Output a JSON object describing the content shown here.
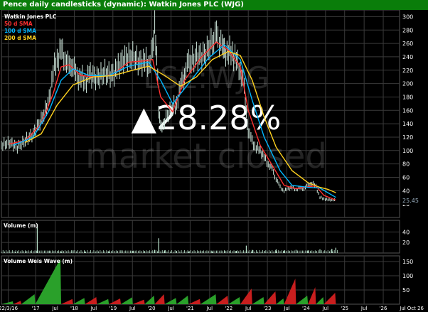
{
  "chart_data": {
    "type": "candlestick",
    "title": "Pence daily candlesticks (dynamic): Watkin Jones PLC (WJG)",
    "watermark": {
      "symbol": "LSE:WJG",
      "change": "▲28.28%",
      "status": "market closed"
    },
    "legend": [
      {
        "name": "Watkin Jones PLC",
        "color": "#ffffff"
      },
      {
        "name": "50 d SMA",
        "color": "#ff3030"
      },
      {
        "name": "100 d SMA",
        "color": "#00b7ff"
      },
      {
        "name": "200 d SMA",
        "color": "#ffd21f"
      }
    ],
    "x_ticks": [
      "22/3/16",
      "'17",
      "Jul",
      "'18",
      "Jul",
      "'19",
      "Jul",
      "'20",
      "Jul",
      "'21",
      "Jul",
      "'22",
      "Jul",
      "'23",
      "Jul",
      "'24",
      "Jul",
      "'25",
      "Jul",
      "'26",
      "Jul",
      "Oct 26"
    ],
    "x_tick_fracs": [
      0.017,
      0.086,
      0.135,
      0.183,
      0.232,
      0.28,
      0.329,
      0.377,
      0.426,
      0.474,
      0.523,
      0.571,
      0.62,
      0.668,
      0.717,
      0.765,
      0.814,
      0.862,
      0.911,
      0.959,
      1.008,
      1.04
    ],
    "price_axis": {
      "ylim": [
        0,
        310
      ],
      "ticks": [
        20,
        40,
        60,
        80,
        100,
        120,
        140,
        160,
        180,
        200,
        220,
        240,
        260,
        280,
        300
      ],
      "last_price": "25.45"
    },
    "price_series": [
      [
        0.0,
        108
      ],
      [
        0.02,
        112
      ],
      [
        0.04,
        105
      ],
      [
        0.06,
        115
      ],
      [
        0.08,
        125
      ],
      [
        0.1,
        145
      ],
      [
        0.12,
        175
      ],
      [
        0.13,
        220
      ],
      [
        0.14,
        235
      ],
      [
        0.15,
        250
      ],
      [
        0.16,
        238
      ],
      [
        0.17,
        222
      ],
      [
        0.18,
        232
      ],
      [
        0.19,
        205
      ],
      [
        0.2,
        212
      ],
      [
        0.21,
        200
      ],
      [
        0.22,
        214
      ],
      [
        0.24,
        208
      ],
      [
        0.26,
        216
      ],
      [
        0.28,
        212
      ],
      [
        0.29,
        222
      ],
      [
        0.31,
        238
      ],
      [
        0.33,
        240
      ],
      [
        0.35,
        230
      ],
      [
        0.36,
        235
      ],
      [
        0.37,
        228
      ],
      [
        0.38,
        250
      ],
      [
        0.385,
        284
      ],
      [
        0.39,
        248
      ],
      [
        0.395,
        160
      ],
      [
        0.4,
        133
      ],
      [
        0.41,
        145
      ],
      [
        0.43,
        165
      ],
      [
        0.44,
        170
      ],
      [
        0.45,
        195
      ],
      [
        0.46,
        215
      ],
      [
        0.47,
        230
      ],
      [
        0.49,
        240
      ],
      [
        0.51,
        242
      ],
      [
        0.53,
        262
      ],
      [
        0.54,
        270
      ],
      [
        0.555,
        258
      ],
      [
        0.56,
        245
      ],
      [
        0.57,
        250
      ],
      [
        0.58,
        244
      ],
      [
        0.59,
        234
      ],
      [
        0.6,
        222
      ],
      [
        0.61,
        192
      ],
      [
        0.615,
        155
      ],
      [
        0.62,
        130
      ],
      [
        0.63,
        112
      ],
      [
        0.64,
        105
      ],
      [
        0.65,
        100
      ],
      [
        0.66,
        90
      ],
      [
        0.67,
        80
      ],
      [
        0.68,
        72
      ],
      [
        0.69,
        58
      ],
      [
        0.7,
        45
      ],
      [
        0.71,
        40
      ],
      [
        0.72,
        43
      ],
      [
        0.73,
        45
      ],
      [
        0.74,
        42
      ],
      [
        0.75,
        44
      ],
      [
        0.76,
        43
      ],
      [
        0.77,
        48
      ],
      [
        0.78,
        52
      ],
      [
        0.79,
        46
      ],
      [
        0.8,
        30
      ],
      [
        0.81,
        28
      ],
      [
        0.82,
        26
      ],
      [
        0.83,
        27
      ],
      [
        0.84,
        25
      ]
    ],
    "sma_50": [
      [
        0.02,
        110
      ],
      [
        0.06,
        115
      ],
      [
        0.1,
        140
      ],
      [
        0.13,
        185
      ],
      [
        0.15,
        225
      ],
      [
        0.17,
        228
      ],
      [
        0.2,
        212
      ],
      [
        0.24,
        210
      ],
      [
        0.28,
        214
      ],
      [
        0.32,
        232
      ],
      [
        0.36,
        234
      ],
      [
        0.38,
        236
      ],
      [
        0.4,
        180
      ],
      [
        0.43,
        158
      ],
      [
        0.46,
        205
      ],
      [
        0.5,
        238
      ],
      [
        0.54,
        262
      ],
      [
        0.57,
        250
      ],
      [
        0.6,
        225
      ],
      [
        0.62,
        160
      ],
      [
        0.65,
        108
      ],
      [
        0.68,
        78
      ],
      [
        0.71,
        48
      ],
      [
        0.74,
        43
      ],
      [
        0.77,
        46
      ],
      [
        0.79,
        47
      ],
      [
        0.81,
        33
      ],
      [
        0.84,
        26
      ]
    ],
    "sma_100": [
      [
        0.03,
        108
      ],
      [
        0.08,
        120
      ],
      [
        0.12,
        160
      ],
      [
        0.15,
        205
      ],
      [
        0.18,
        222
      ],
      [
        0.22,
        212
      ],
      [
        0.27,
        212
      ],
      [
        0.32,
        226
      ],
      [
        0.37,
        232
      ],
      [
        0.4,
        205
      ],
      [
        0.43,
        170
      ],
      [
        0.47,
        200
      ],
      [
        0.52,
        238
      ],
      [
        0.56,
        258
      ],
      [
        0.6,
        236
      ],
      [
        0.63,
        175
      ],
      [
        0.66,
        120
      ],
      [
        0.7,
        70
      ],
      [
        0.73,
        48
      ],
      [
        0.77,
        45
      ],
      [
        0.8,
        44
      ],
      [
        0.84,
        30
      ]
    ],
    "sma_200": [
      [
        0.06,
        112
      ],
      [
        0.1,
        125
      ],
      [
        0.14,
        168
      ],
      [
        0.18,
        198
      ],
      [
        0.23,
        210
      ],
      [
        0.28,
        212
      ],
      [
        0.33,
        220
      ],
      [
        0.37,
        226
      ],
      [
        0.41,
        212
      ],
      [
        0.45,
        196
      ],
      [
        0.49,
        210
      ],
      [
        0.53,
        236
      ],
      [
        0.57,
        248
      ],
      [
        0.6,
        242
      ],
      [
        0.63,
        205
      ],
      [
        0.66,
        150
      ],
      [
        0.69,
        105
      ],
      [
        0.73,
        70
      ],
      [
        0.77,
        52
      ],
      [
        0.8,
        45
      ],
      [
        0.82,
        42
      ],
      [
        0.84,
        37
      ]
    ],
    "volume_panel": {
      "label": "Volume (m)",
      "ylim": [
        0,
        62
      ],
      "ticks": [
        20,
        40
      ],
      "bars": [
        [
          0.035,
          2
        ],
        [
          0.06,
          3
        ],
        [
          0.09,
          55
        ],
        [
          0.12,
          4
        ],
        [
          0.15,
          3
        ],
        [
          0.18,
          5
        ],
        [
          0.21,
          3
        ],
        [
          0.24,
          4
        ],
        [
          0.27,
          3
        ],
        [
          0.3,
          5
        ],
        [
          0.33,
          4
        ],
        [
          0.36,
          3
        ],
        [
          0.385,
          6
        ],
        [
          0.395,
          28
        ],
        [
          0.41,
          5
        ],
        [
          0.44,
          4
        ],
        [
          0.47,
          3
        ],
        [
          0.5,
          4
        ],
        [
          0.53,
          3
        ],
        [
          0.56,
          5
        ],
        [
          0.59,
          4
        ],
        [
          0.615,
          14
        ],
        [
          0.63,
          6
        ],
        [
          0.66,
          4
        ],
        [
          0.69,
          7
        ],
        [
          0.71,
          5
        ],
        [
          0.74,
          6
        ],
        [
          0.77,
          5
        ],
        [
          0.8,
          7
        ],
        [
          0.83,
          8
        ],
        [
          0.84,
          10
        ]
      ]
    },
    "weis_panel": {
      "label": "Volume Weis Wave (m)",
      "ylim": [
        0,
        170
      ],
      "ticks": [
        50,
        100,
        150
      ],
      "waves": [
        [
          0.0,
          0.03,
          10,
          "#2aa02a"
        ],
        [
          0.03,
          0.05,
          12,
          "#c81e1e"
        ],
        [
          0.05,
          0.085,
          35,
          "#2aa02a"
        ],
        [
          0.085,
          0.15,
          160,
          "#2aa02a"
        ],
        [
          0.15,
          0.18,
          18,
          "#c81e1e"
        ],
        [
          0.18,
          0.21,
          22,
          "#2aa02a"
        ],
        [
          0.21,
          0.24,
          25,
          "#c81e1e"
        ],
        [
          0.24,
          0.27,
          18,
          "#2aa02a"
        ],
        [
          0.27,
          0.3,
          20,
          "#c81e1e"
        ],
        [
          0.3,
          0.33,
          24,
          "#2aa02a"
        ],
        [
          0.33,
          0.36,
          16,
          "#c81e1e"
        ],
        [
          0.36,
          0.385,
          30,
          "#2aa02a"
        ],
        [
          0.385,
          0.41,
          35,
          "#c81e1e"
        ],
        [
          0.41,
          0.44,
          22,
          "#2aa02a"
        ],
        [
          0.44,
          0.47,
          30,
          "#2aa02a"
        ],
        [
          0.47,
          0.5,
          18,
          "#c81e1e"
        ],
        [
          0.5,
          0.54,
          35,
          "#2aa02a"
        ],
        [
          0.54,
          0.57,
          30,
          "#c81e1e"
        ],
        [
          0.57,
          0.6,
          25,
          "#2aa02a"
        ],
        [
          0.6,
          0.63,
          55,
          "#c81e1e"
        ],
        [
          0.63,
          0.66,
          25,
          "#2aa02a"
        ],
        [
          0.66,
          0.69,
          45,
          "#c81e1e"
        ],
        [
          0.69,
          0.71,
          20,
          "#2aa02a"
        ],
        [
          0.71,
          0.74,
          90,
          "#c81e1e"
        ],
        [
          0.74,
          0.77,
          30,
          "#2aa02a"
        ],
        [
          0.77,
          0.79,
          60,
          "#c81e1e"
        ],
        [
          0.79,
          0.81,
          25,
          "#2aa02a"
        ],
        [
          0.81,
          0.84,
          40,
          "#c81e1e"
        ]
      ]
    },
    "colors": {
      "background": "#000000",
      "grid": "#3a3a3a",
      "price": "#cfe8dd",
      "volume": "#bde6cf",
      "title_bar": "#0a7d0a"
    }
  }
}
